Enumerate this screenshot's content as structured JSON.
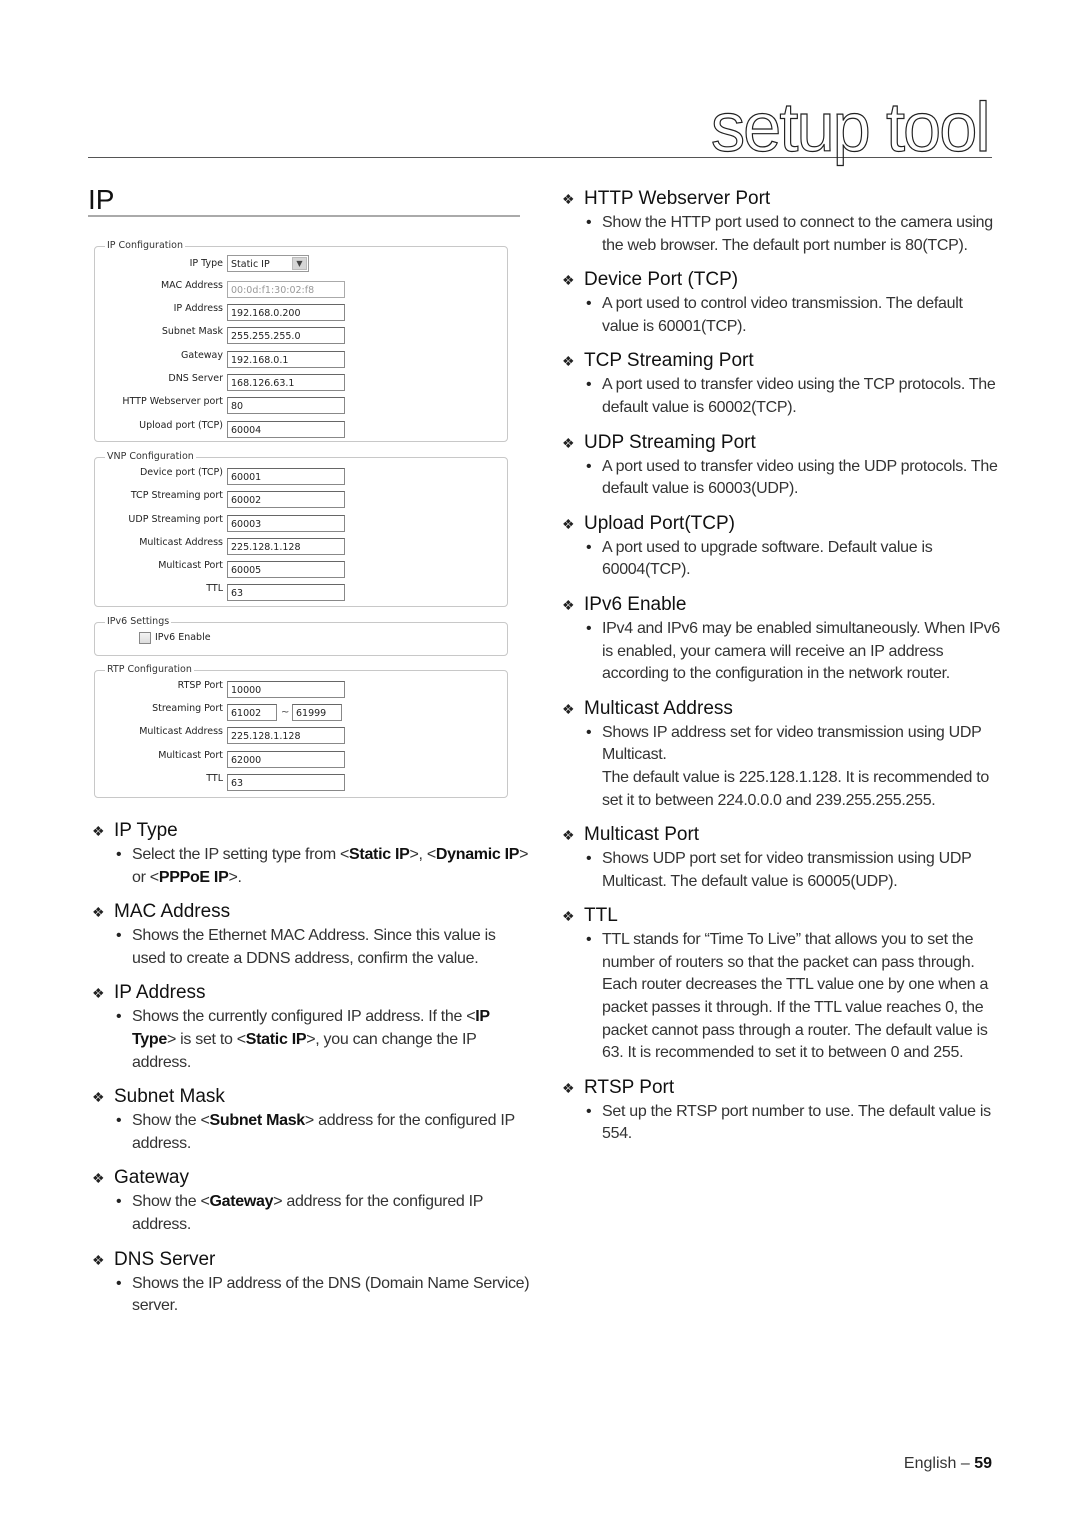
{
  "page": {
    "chapter": "setup tool",
    "section_title": "IP",
    "footer_lang": "English –",
    "footer_page": "59"
  },
  "form": {
    "ip_config": {
      "legend": "IP Configuration",
      "ip_type": {
        "label": "IP Type",
        "value": "Static IP"
      },
      "mac_address": {
        "label": "MAC Address",
        "value": "00:0d:f1:30:02:f8"
      },
      "ip_address": {
        "label": "IP Address",
        "value": "192.168.0.200"
      },
      "subnet_mask": {
        "label": "Subnet Mask",
        "value": "255.255.255.0"
      },
      "gateway": {
        "label": "Gateway",
        "value": "192.168.0.1"
      },
      "dns_server": {
        "label": "DNS Server",
        "value": "168.126.63.1"
      },
      "http_port": {
        "label": "HTTP Webserver port",
        "value": "80"
      },
      "upload_port": {
        "label": "Upload port (TCP)",
        "value": "60004"
      }
    },
    "vnp_config": {
      "legend": "VNP Configuration",
      "device_port": {
        "label": "Device port (TCP)",
        "value": "60001"
      },
      "tcp_streaming": {
        "label": "TCP Streaming port",
        "value": "60002"
      },
      "udp_streaming": {
        "label": "UDP Streaming port",
        "value": "60003"
      },
      "multicast_address": {
        "label": "Multicast Address",
        "value": "225.128.1.128"
      },
      "multicast_port": {
        "label": "Multicast Port",
        "value": "60005"
      },
      "ttl": {
        "label": "TTL",
        "value": "63"
      }
    },
    "ipv6": {
      "legend": "IPv6 Settings",
      "enable_label": "IPv6 Enable",
      "enabled": false
    },
    "rtp_config": {
      "legend": "RTP Configuration",
      "rtsp_port": {
        "label": "RTSP Port",
        "value": "10000"
      },
      "streaming_port": {
        "label": "Streaming Port",
        "from": "61002",
        "separator": "~",
        "to": "61999"
      },
      "multicast_address": {
        "label": "Multicast Address",
        "value": "225.128.1.128"
      },
      "multicast_port": {
        "label": "Multicast Port",
        "value": "62000"
      },
      "ttl": {
        "label": "TTL",
        "value": "63"
      }
    }
  },
  "left_items": [
    {
      "title": "IP Type",
      "body": [
        "Select the IP setting type from <",
        "Static IP",
        ">, <",
        "Dynamic IP",
        "> or <",
        "PPPoE IP",
        ">."
      ]
    },
    {
      "title": "MAC Address",
      "body": "Shows the Ethernet MAC Address. Since this value is used to create a DDNS address, confirm the value."
    },
    {
      "title": "IP Address",
      "body": [
        "Shows the currently configured IP address. If the <",
        "IP Type",
        "> is set to <",
        "Static IP",
        ">, you can change the IP address."
      ]
    },
    {
      "title": "Subnet Mask",
      "body": [
        "Show the <",
        "Subnet Mask",
        "> address for the configured IP address."
      ]
    },
    {
      "title": "Gateway",
      "body": [
        "Show the <",
        "Gateway",
        "> address for the configured IP address."
      ]
    },
    {
      "title": "DNS Server",
      "body": "Shows the IP address of the DNS (Domain Name Service) server."
    }
  ],
  "right_items": [
    {
      "title": "HTTP Webserver Port",
      "body": "Show the HTTP port used to connect to the camera using the web browser. The default port number is 80(TCP)."
    },
    {
      "title": "Device Port (TCP)",
      "body": "A port used to control video transmission. The default value is 60001(TCP)."
    },
    {
      "title": "TCP Streaming Port",
      "body": "A port used to transfer video using the TCP protocols. The default value is 60002(TCP)."
    },
    {
      "title": "UDP Streaming Port",
      "body": "A port used to transfer video using the UDP protocols. The default value is 60003(UDP)."
    },
    {
      "title": "Upload Port(TCP)",
      "body": "A port used to upgrade software. Default value is 60004(TCP)."
    },
    {
      "title": "IPv6 Enable",
      "body": "IPv4 and IPv6 may be enabled simultaneously. When IPv6 is enabled, your camera will receive an IP address according to the configuration in the network router."
    },
    {
      "title": "Multicast Address",
      "body": "Shows IP address set for video transmission using UDP Multicast.",
      "body2": "The default value is 225.128.1.128. It is recommended to set it to between 224.0.0.0 and 239.255.255.255."
    },
    {
      "title": "Multicast Port",
      "body": "Shows UDP port set for video transmission using UDP Multicast. The default value is 60005(UDP)."
    },
    {
      "title": "TTL",
      "body": "TTL stands for “Time To Live” that allows you to set the number of routers so that the packet can pass through. Each router decreases the TTL value one by one when a packet passes it through. If the TTL value reaches 0, the packet cannot pass through a router. The default value is 63. It is recommended to set it to between 0 and 255."
    },
    {
      "title": "RTSP Port",
      "body": "Set up the RTSP port number to use. The default value is 554."
    }
  ]
}
